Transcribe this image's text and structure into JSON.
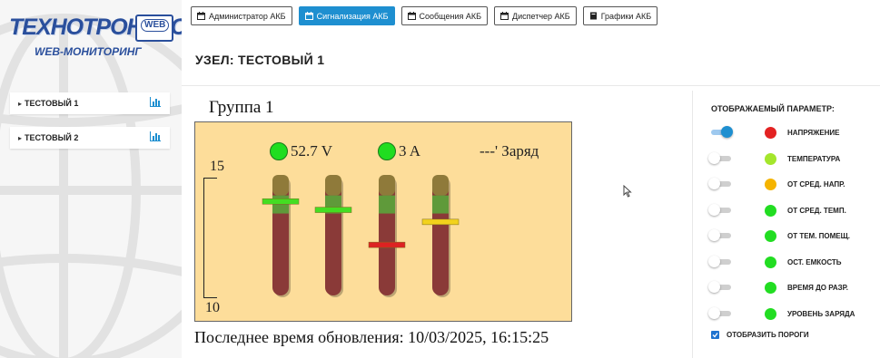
{
  "brand": {
    "main": "ТЕХНОТРОНИКС",
    "sub": "WEB-МОНИТОРИНГ",
    "badge": "WEB"
  },
  "sidebar": {
    "nodes": [
      {
        "label": "ТЕСТОВЫЙ 1",
        "icon": "bar-chart-icon"
      },
      {
        "label": "ТЕСТОВЫЙ 2",
        "icon": "bar-chart-icon"
      }
    ]
  },
  "toolbar": {
    "buttons": [
      {
        "label": "Администратор АКБ",
        "icon": "calendar-icon",
        "active": false
      },
      {
        "label": "Сигнализация АКБ",
        "icon": "calendar-icon",
        "active": true
      },
      {
        "label": "Сообщения АКБ",
        "icon": "calendar-icon",
        "active": false
      },
      {
        "label": "Диспетчер АКБ",
        "icon": "calendar-icon",
        "active": false
      },
      {
        "label": "Графики АКБ",
        "icon": "book-icon",
        "active": false
      }
    ]
  },
  "page": {
    "title": "УЗЕЛ: ТЕСТОВЫЙ 1"
  },
  "group": {
    "title": "Группа 1",
    "scale_max": "15",
    "scale_min": "10",
    "voltage": "52.7 V",
    "current": "3 A",
    "charge": "---' Заряд",
    "last_update": "Последнее время обновления: 10/03/2025, 16:15:25",
    "bars": [
      {
        "level": 0.78,
        "marker_color": "#44dd22"
      },
      {
        "level": 0.71,
        "marker_color": "#44dd22"
      },
      {
        "level": 0.42,
        "marker_color": "#dd2222"
      },
      {
        "level": 0.61,
        "marker_color": "#f2d21c"
      }
    ]
  },
  "params": {
    "title": "ОТОБРАЖАЕМЫЙ ПАРАМЕТР:",
    "items": [
      {
        "label": "НАПРЯЖЕНИЕ",
        "color": "#e32222",
        "on": true
      },
      {
        "label": "ТЕМПЕРАТУРА",
        "color": "#a4e62c",
        "on": false
      },
      {
        "label": "ОТ СРЕД. НАПР.",
        "color": "#f5b400",
        "on": false
      },
      {
        "label": "ОТ СРЕД. ТЕМП.",
        "color": "#22dd22",
        "on": false
      },
      {
        "label": "ОТ ТЕМ. ПОМЕЩ.",
        "color": "#22dd22",
        "on": false
      },
      {
        "label": "ОСТ. ЕМКОСТЬ",
        "color": "#22dd22",
        "on": false
      },
      {
        "label": "ВРЕМЯ ДО РАЗР.",
        "color": "#22dd22",
        "on": false
      },
      {
        "label": "УРОВЕНЬ ЗАРЯДА",
        "color": "#22dd22",
        "on": false
      }
    ],
    "show_thresholds_label": "ОТОБРАЗИТЬ ПОРОГИ",
    "show_thresholds": true
  }
}
